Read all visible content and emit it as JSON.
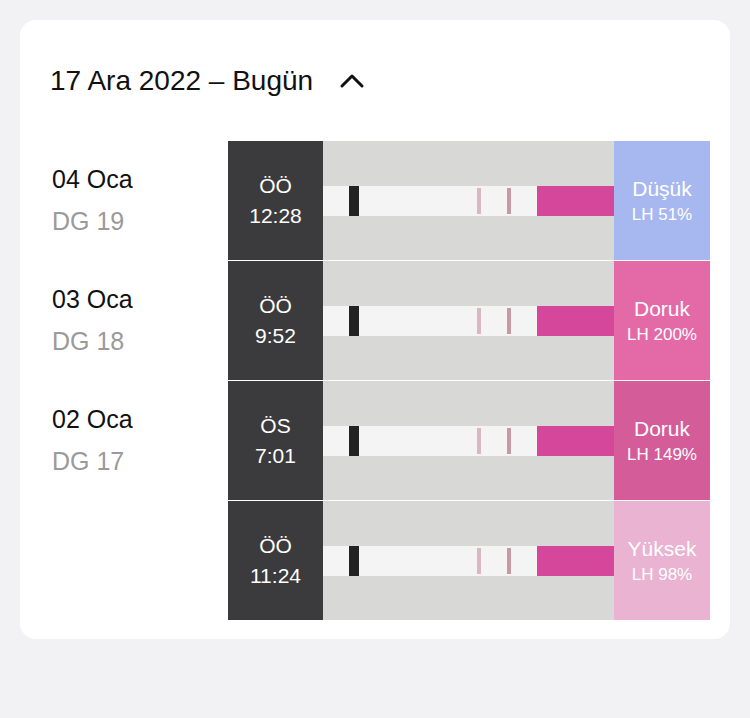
{
  "header": {
    "title": "17 Ara 2022 – Bugün",
    "expanded": true
  },
  "groups": [
    {
      "date": "04 Oca",
      "cycle_day": "DG 19",
      "entries": [
        {
          "period": "ÖÖ",
          "time": "12:28",
          "level_label": "Düşük",
          "reading": "LH 51%",
          "color": "#a7b8f0"
        }
      ]
    },
    {
      "date": "03 Oca",
      "cycle_day": "DG 18",
      "entries": [
        {
          "period": "ÖÖ",
          "time": "9:52",
          "level_label": "Doruk",
          "reading": "LH 200%",
          "color": "#e46aa7"
        }
      ]
    },
    {
      "date": "02 Oca",
      "cycle_day": "DG 17",
      "entries": [
        {
          "period": "ÖS",
          "time": "7:01",
          "level_label": "Doruk",
          "reading": "LH 149%",
          "color": "#d45c99"
        },
        {
          "period": "ÖÖ",
          "time": "11:24",
          "level_label": "Yüksek",
          "reading": "LH 98%",
          "color": "#e9b3d1"
        }
      ]
    }
  ]
}
